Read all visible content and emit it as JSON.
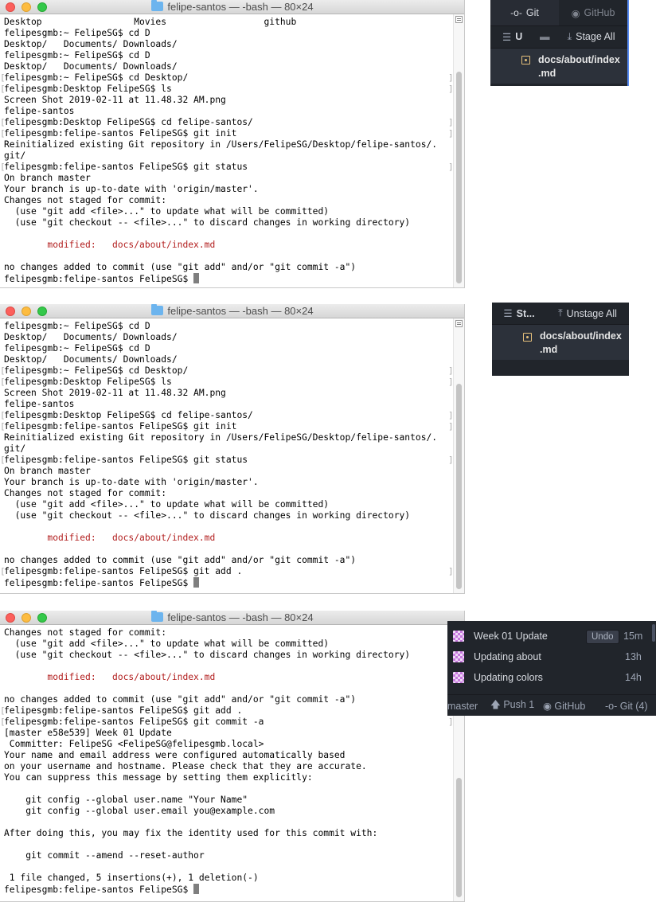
{
  "windows": [
    {
      "title": "felipe-santos — -bash — 80×24",
      "lines": [
        {
          "text": "Desktop                 Movies                  github"
        },
        {
          "text": "felipesgmb:~ FelipeSG$ cd D"
        },
        {
          "text": "Desktop/   Documents/ Downloads/"
        },
        {
          "text": "felipesgmb:~ FelipeSG$ cd D"
        },
        {
          "text": "Desktop/   Documents/ Downloads/"
        },
        {
          "text": "felipesgmb:~ FelipeSG$ cd Desktop/",
          "brackets": true
        },
        {
          "text": "felipesgmb:Desktop FelipeSG$ ls",
          "brackets": true
        },
        {
          "text": "Screen Shot 2019-02-11 at 11.48.32 AM.png"
        },
        {
          "text": "felipe-santos"
        },
        {
          "text": "felipesgmb:Desktop FelipeSG$ cd felipe-santos/",
          "brackets": true
        },
        {
          "text": "felipesgmb:felipe-santos FelipeSG$ git init",
          "brackets": true
        },
        {
          "text": "Reinitialized existing Git repository in /Users/FelipeSG/Desktop/felipe-santos/."
        },
        {
          "text": "git/"
        },
        {
          "text": "felipesgmb:felipe-santos FelipeSG$ git status",
          "brackets": true
        },
        {
          "text": "On branch master"
        },
        {
          "text": "Your branch is up-to-date with 'origin/master'."
        },
        {
          "text": "Changes not staged for commit:"
        },
        {
          "text": "  (use \"git add <file>...\" to update what will be committed)"
        },
        {
          "text": "  (use \"git checkout -- <file>...\" to discard changes in working directory)"
        },
        {
          "text": ""
        },
        {
          "text": "        modified:   docs/about/index.md",
          "red": true
        },
        {
          "text": ""
        },
        {
          "text": "no changes added to commit (use \"git add\" and/or \"git commit -a\")"
        },
        {
          "text": "felipesgmb:felipe-santos FelipeSG$ ",
          "cursor": true
        }
      ]
    },
    {
      "title": "felipe-santos — -bash — 80×24",
      "lines": [
        {
          "text": "felipesgmb:~ FelipeSG$ cd D"
        },
        {
          "text": "Desktop/   Documents/ Downloads/"
        },
        {
          "text": "felipesgmb:~ FelipeSG$ cd D"
        },
        {
          "text": "Desktop/   Documents/ Downloads/"
        },
        {
          "text": "felipesgmb:~ FelipeSG$ cd Desktop/",
          "brackets": true
        },
        {
          "text": "felipesgmb:Desktop FelipeSG$ ls",
          "brackets": true
        },
        {
          "text": "Screen Shot 2019-02-11 at 11.48.32 AM.png"
        },
        {
          "text": "felipe-santos"
        },
        {
          "text": "felipesgmb:Desktop FelipeSG$ cd felipe-santos/",
          "brackets": true
        },
        {
          "text": "felipesgmb:felipe-santos FelipeSG$ git init",
          "brackets": true
        },
        {
          "text": "Reinitialized existing Git repository in /Users/FelipeSG/Desktop/felipe-santos/."
        },
        {
          "text": "git/"
        },
        {
          "text": "felipesgmb:felipe-santos FelipeSG$ git status",
          "brackets": true
        },
        {
          "text": "On branch master"
        },
        {
          "text": "Your branch is up-to-date with 'origin/master'."
        },
        {
          "text": "Changes not staged for commit:"
        },
        {
          "text": "  (use \"git add <file>...\" to update what will be committed)"
        },
        {
          "text": "  (use \"git checkout -- <file>...\" to discard changes in working directory)"
        },
        {
          "text": ""
        },
        {
          "text": "        modified:   docs/about/index.md",
          "red": true
        },
        {
          "text": ""
        },
        {
          "text": "no changes added to commit (use \"git add\" and/or \"git commit -a\")"
        },
        {
          "text": "felipesgmb:felipe-santos FelipeSG$ git add .",
          "brackets": true
        },
        {
          "text": "felipesgmb:felipe-santos FelipeSG$ ",
          "cursor": true
        }
      ]
    },
    {
      "title": "felipe-santos — -bash — 80×24",
      "lines": [
        {
          "text": "Changes not staged for commit:"
        },
        {
          "text": "  (use \"git add <file>...\" to update what will be committed)"
        },
        {
          "text": "  (use \"git checkout -- <file>...\" to discard changes in working directory)"
        },
        {
          "text": ""
        },
        {
          "text": "        modified:   docs/about/index.md",
          "red": true
        },
        {
          "text": ""
        },
        {
          "text": "no changes added to commit (use \"git add\" and/or \"git commit -a\")"
        },
        {
          "text": "felipesgmb:felipe-santos FelipeSG$ git add .",
          "brackets": true
        },
        {
          "text": "felipesgmb:felipe-santos FelipeSG$ git commit -a",
          "brackets": true
        },
        {
          "text": "[master e58e539] Week 01 Update"
        },
        {
          "text": " Committer: FelipeSG <FelipeSG@felipesgmb.local>"
        },
        {
          "text": "Your name and email address were configured automatically based"
        },
        {
          "text": "on your username and hostname. Please check that they are accurate."
        },
        {
          "text": "You can suppress this message by setting them explicitly:"
        },
        {
          "text": ""
        },
        {
          "text": "    git config --global user.name \"Your Name\""
        },
        {
          "text": "    git config --global user.email you@example.com"
        },
        {
          "text": ""
        },
        {
          "text": "After doing this, you may fix the identity used for this commit with:"
        },
        {
          "text": ""
        },
        {
          "text": "    git commit --amend --reset-author"
        },
        {
          "text": ""
        },
        {
          "text": " 1 file changed, 5 insertions(+), 1 deletion(-)"
        },
        {
          "text": "felipesgmb:felipe-santos FelipeSG$ ",
          "cursor": true
        }
      ]
    }
  ],
  "git_panel_1": {
    "tab_git": "Git",
    "tab_github": "GitHub",
    "unstaged_label": "U",
    "stage_all_label": "Stage All",
    "file_line1": "docs/about/index",
    "file_line2": ".md"
  },
  "git_panel_2": {
    "staged_label": "St...",
    "unstage_all_label": "Unstage All",
    "file_line1": "docs/about/index",
    "file_line2": ".md"
  },
  "git_panel_3": {
    "commits": [
      {
        "message": "Week 01 Update",
        "time": "15m",
        "undo": "Undo"
      },
      {
        "message": "Updating about",
        "time": "13h"
      },
      {
        "message": "Updating colors",
        "time": "14h"
      }
    ],
    "status_bar": {
      "branch": "master",
      "push": "Push 1",
      "github": "GitHub",
      "git": "Git (4)"
    }
  },
  "colors": {
    "terminal_bg": "#ffffff",
    "modified_text": "#b21e1e",
    "panel_bg": "#21252b",
    "accent_blue": "#568af2"
  }
}
